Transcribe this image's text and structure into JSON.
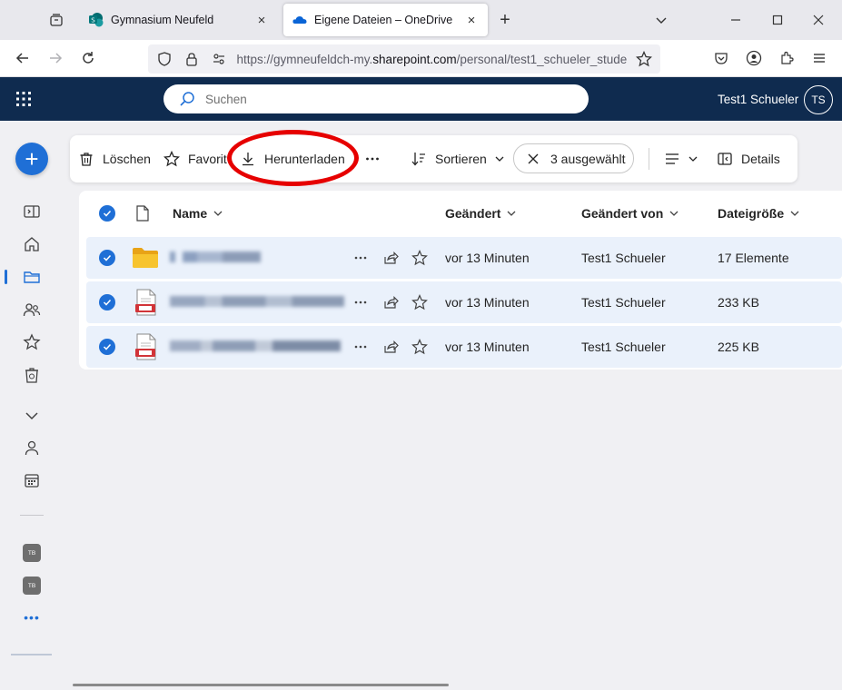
{
  "browser": {
    "tabs": [
      {
        "label": "Gymnasium Neufeld",
        "active": false,
        "favicon": "sharepoint-icon"
      },
      {
        "label": "Eigene Dateien – OneDrive",
        "active": true,
        "favicon": "onedrive-icon"
      }
    ],
    "url_prefix": "https://gymneufeldch-my.",
    "url_host": "sharepoint.com",
    "url_path": "/personal/test1_schueler_stude"
  },
  "header": {
    "search_placeholder": "Suchen",
    "user_name": "Test1 Schueler",
    "avatar_initials": "TS",
    "color": "#0f2b4f"
  },
  "rail": {
    "badges": [
      "TB",
      "TB"
    ]
  },
  "commandbar": {
    "delete": "Löschen",
    "favorite": "Favorit",
    "download": "Herunterladen",
    "sort": "Sortieren",
    "selected": "3 ausgewählt",
    "details": "Details"
  },
  "list": {
    "columns": {
      "name": "Name",
      "modified": "Geändert",
      "modified_by": "Geändert von",
      "size": "Dateigröße"
    },
    "rows": [
      {
        "type": "folder",
        "modified": "vor 13 Minuten",
        "modified_by": "Test1 Schueler",
        "size": "17 Elemente"
      },
      {
        "type": "pdf",
        "modified": "vor 13 Minuten",
        "modified_by": "Test1 Schueler",
        "size": "233 KB"
      },
      {
        "type": "pdf",
        "modified": "vor 13 Minuten",
        "modified_by": "Test1 Schueler",
        "size": "225 KB"
      }
    ]
  },
  "colors": {
    "accent": "#1f6fd6",
    "highlight": "#e60000",
    "row_selected": "#eaf1fb"
  }
}
